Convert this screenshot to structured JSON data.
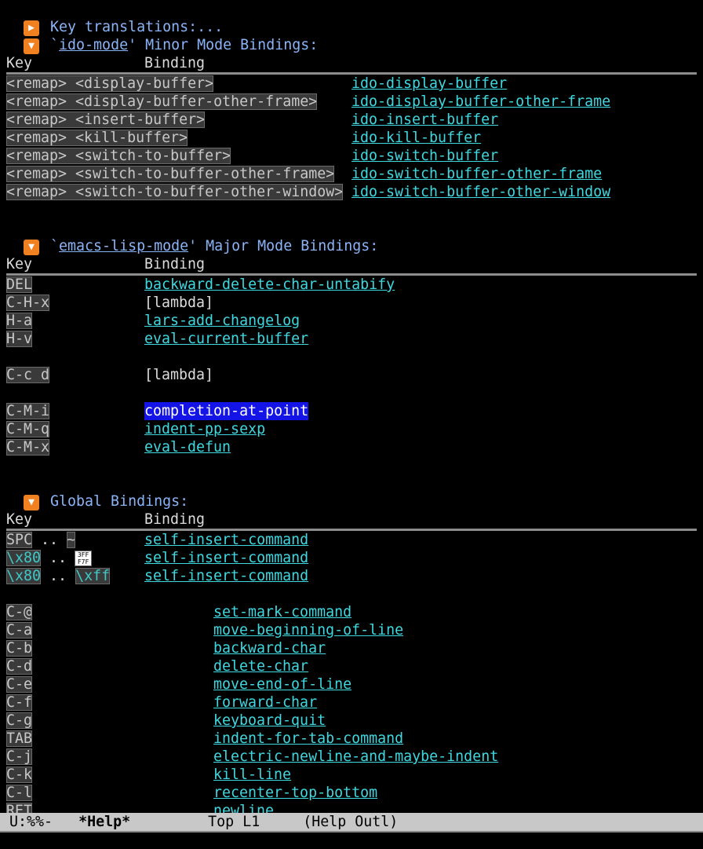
{
  "buffer": {
    "key_translations": "Key translations:...",
    "collapsed_icon": "▶",
    "expanded_icon": "▼",
    "ido_section": {
      "prefix": "`",
      "mode_link": "ido-mode",
      "suffix": "' Minor Mode Bindings:"
    },
    "elisp_section": {
      "prefix": "`",
      "mode_link": "emacs-lisp-mode",
      "suffix": "' Major Mode Bindings:"
    },
    "global_section": {
      "title": "Global Bindings:"
    },
    "col_key": "Key",
    "col_binding": "Binding",
    "ido_rows": [
      {
        "key": "<remap> <display-buffer>",
        "cmd": "ido-display-buffer"
      },
      {
        "key": "<remap> <display-buffer-other-frame>",
        "cmd": "ido-display-buffer-other-frame"
      },
      {
        "key": "<remap> <insert-buffer>",
        "cmd": "ido-insert-buffer"
      },
      {
        "key": "<remap> <kill-buffer>",
        "cmd": "ido-kill-buffer"
      },
      {
        "key": "<remap> <switch-to-buffer>",
        "cmd": "ido-switch-buffer"
      },
      {
        "key": "<remap> <switch-to-buffer-other-frame>",
        "cmd": "ido-switch-buffer-other-frame"
      },
      {
        "key": "<remap> <switch-to-buffer-other-window>",
        "cmd": "ido-switch-buffer-other-window"
      }
    ],
    "elisp_rows": [
      {
        "key": "DEL",
        "cmd": "backward-delete-char-untabify"
      },
      {
        "key": "C-H-x",
        "cmd": "[lambda]"
      },
      {
        "key": "H-a",
        "cmd": "lars-add-changelog"
      },
      {
        "key": "H-v",
        "cmd": "eval-current-buffer"
      },
      {
        "key": "C-c d",
        "cmd": "[lambda]"
      },
      {
        "key": "C-M-i",
        "cmd": "completion-at-point"
      },
      {
        "key": "C-M-q",
        "cmd": "indent-pp-sexp"
      },
      {
        "key": "C-M-x",
        "cmd": "eval-defun"
      }
    ],
    "global_range_rows": [
      {
        "k1": "SPC",
        "sep": " .. ",
        "k2": "~",
        "cmd": "self-insert-command"
      },
      {
        "k1": "\\x80",
        "sep": " .. ",
        "k2": "3FF F7F",
        "cmd": "self-insert-command"
      },
      {
        "k1": "\\x80",
        "sep": " .. ",
        "k2": "\\xff",
        "cmd": "self-insert-command"
      }
    ],
    "global_rows": [
      {
        "key": "C-@",
        "cmd": "set-mark-command"
      },
      {
        "key": "C-a",
        "cmd": "move-beginning-of-line"
      },
      {
        "key": "C-b",
        "cmd": "backward-char"
      },
      {
        "key": "C-d",
        "cmd": "delete-char"
      },
      {
        "key": "C-e",
        "cmd": "move-end-of-line"
      },
      {
        "key": "C-f",
        "cmd": "forward-char"
      },
      {
        "key": "C-g",
        "cmd": "keyboard-quit"
      },
      {
        "key": "TAB",
        "cmd": "indent-for-tab-command"
      },
      {
        "key": "C-j",
        "cmd": "electric-newline-and-maybe-indent"
      },
      {
        "key": "C-k",
        "cmd": "kill-line"
      },
      {
        "key": "C-l",
        "cmd": "recenter-top-bottom"
      },
      {
        "key": "RET",
        "cmd": "newline"
      }
    ]
  },
  "modeline": {
    "status": "U:%%-",
    "buffer_name": "*Help*",
    "position": "Top L1",
    "mode": "(Help Outl)"
  },
  "colors": {
    "link": "#3fd8e0",
    "heading": "#8ab4f8",
    "icon": "#f08020",
    "selection": "#1414e6"
  }
}
